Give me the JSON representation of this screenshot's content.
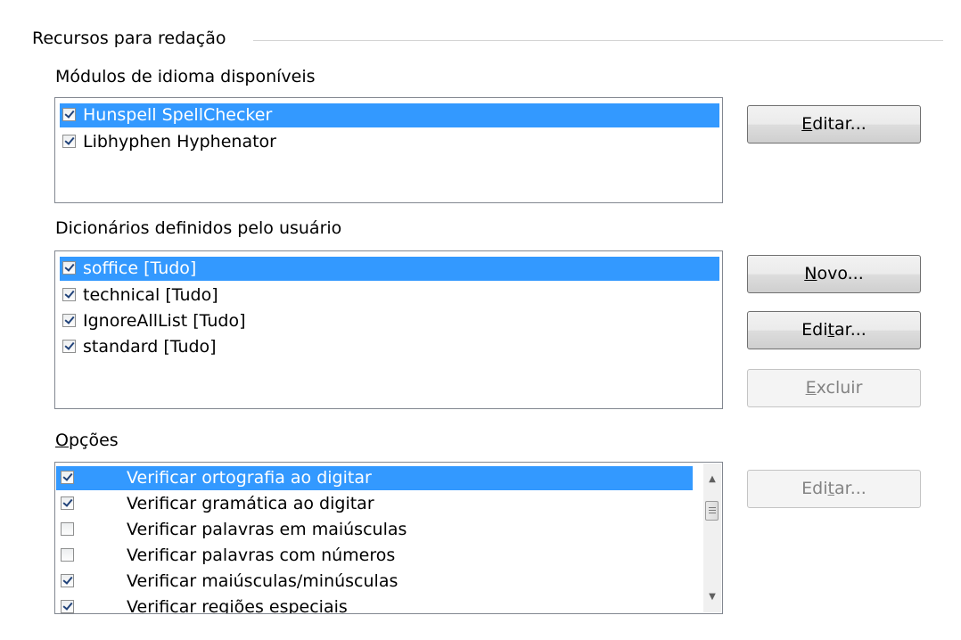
{
  "section": {
    "title": "Recursos para redação"
  },
  "modules": {
    "label": "Módulos de idioma disponíveis",
    "items": [
      {
        "label": "Hunspell SpellChecker",
        "checked": true,
        "selected": true
      },
      {
        "label": "Libhyphen Hyphenator",
        "checked": true,
        "selected": false
      }
    ],
    "edit_button": "Editar..."
  },
  "dictionaries": {
    "label": "Dicionários definidos pelo usuário",
    "items": [
      {
        "label": "soffice [Tudo]",
        "checked": true,
        "selected": true
      },
      {
        "label": "technical [Tudo]",
        "checked": true,
        "selected": false
      },
      {
        "label": "IgnoreAllList [Tudo]",
        "checked": true,
        "selected": false
      },
      {
        "label": "standard [Tudo]",
        "checked": true,
        "selected": false
      }
    ],
    "new_button": "Novo...",
    "edit_button": "Editar...",
    "delete_button": "Excluir"
  },
  "options": {
    "label": "Opções",
    "items": [
      {
        "label": "Verificar ortografia ao digitar",
        "checked": true,
        "selected": true
      },
      {
        "label": "Verificar gramática ao digitar",
        "checked": true,
        "selected": false
      },
      {
        "label": "Verificar palavras em maiúsculas",
        "checked": false,
        "selected": false
      },
      {
        "label": "Verificar palavras com números",
        "checked": false,
        "selected": false
      },
      {
        "label": "Verificar maiúsculas/minúsculas",
        "checked": true,
        "selected": false
      },
      {
        "label": "Verificar regiões especiais",
        "checked": true,
        "selected": false
      }
    ],
    "edit_button": "Editar..."
  },
  "icons": {
    "checkbox": "checkbox-icon",
    "scroll_up": "scroll-up-arrow-icon",
    "scroll_down": "scroll-down-arrow-icon",
    "scroll_thumb": "scroll-thumb"
  },
  "colors": {
    "selection": "#3399ff",
    "listbox_border": "#828790",
    "disabled_text": "#838383"
  }
}
